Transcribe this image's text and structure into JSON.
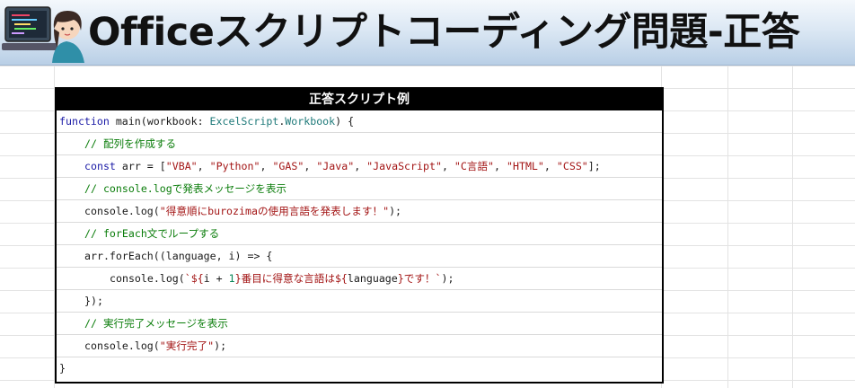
{
  "banner": {
    "title": "Officeスクリプトコーディング問題-正答"
  },
  "code_block": {
    "header": "正答スクリプト例",
    "lines": [
      {
        "indent": 0,
        "tokens": [
          {
            "t": "kw",
            "v": "function"
          },
          {
            "t": "pl",
            "v": " main(workbook: "
          },
          {
            "t": "ty",
            "v": "ExcelScript"
          },
          {
            "t": "pl",
            "v": "."
          },
          {
            "t": "ty",
            "v": "Workbook"
          },
          {
            "t": "pl",
            "v": ") {"
          }
        ]
      },
      {
        "indent": 1,
        "tokens": [
          {
            "t": "cm",
            "v": "// 配列を作成する"
          }
        ]
      },
      {
        "indent": 1,
        "tokens": [
          {
            "t": "kw",
            "v": "const"
          },
          {
            "t": "pl",
            "v": " arr = ["
          },
          {
            "t": "st",
            "v": "\"VBA\""
          },
          {
            "t": "pl",
            "v": ", "
          },
          {
            "t": "st",
            "v": "\"Python\""
          },
          {
            "t": "pl",
            "v": ", "
          },
          {
            "t": "st",
            "v": "\"GAS\""
          },
          {
            "t": "pl",
            "v": ", "
          },
          {
            "t": "st",
            "v": "\"Java\""
          },
          {
            "t": "pl",
            "v": ", "
          },
          {
            "t": "st",
            "v": "\"JavaScript\""
          },
          {
            "t": "pl",
            "v": ", "
          },
          {
            "t": "st",
            "v": "\"C言語\""
          },
          {
            "t": "pl",
            "v": ", "
          },
          {
            "t": "st",
            "v": "\"HTML\""
          },
          {
            "t": "pl",
            "v": ", "
          },
          {
            "t": "st",
            "v": "\"CSS\""
          },
          {
            "t": "pl",
            "v": "];"
          }
        ]
      },
      {
        "indent": 1,
        "tokens": [
          {
            "t": "cm",
            "v": "// console.logで発表メッセージを表示"
          }
        ]
      },
      {
        "indent": 1,
        "tokens": [
          {
            "t": "pl",
            "v": "console.log("
          },
          {
            "t": "st",
            "v": "\"得意順にburozimaの使用言語を発表します！\""
          },
          {
            "t": "pl",
            "v": ");"
          }
        ]
      },
      {
        "indent": 1,
        "tokens": [
          {
            "t": "cm",
            "v": "// forEach文でループする"
          }
        ]
      },
      {
        "indent": 1,
        "tokens": [
          {
            "t": "pl",
            "v": "arr.forEach((language, i) => {"
          }
        ]
      },
      {
        "indent": 2,
        "tokens": [
          {
            "t": "pl",
            "v": "console.log("
          },
          {
            "t": "st",
            "v": "`${"
          },
          {
            "t": "pl",
            "v": "i + "
          },
          {
            "t": "nm",
            "v": "1"
          },
          {
            "t": "st",
            "v": "}番目に得意な言語は${"
          },
          {
            "t": "pl",
            "v": "language"
          },
          {
            "t": "st",
            "v": "}です！`"
          },
          {
            "t": "pl",
            "v": ");"
          }
        ]
      },
      {
        "indent": 1,
        "tokens": [
          {
            "t": "pl",
            "v": "});"
          }
        ]
      },
      {
        "indent": 1,
        "tokens": [
          {
            "t": "cm",
            "v": "// 実行完了メッセージを表示"
          }
        ]
      },
      {
        "indent": 1,
        "tokens": [
          {
            "t": "pl",
            "v": "console.log("
          },
          {
            "t": "st",
            "v": "\"実行完了\""
          },
          {
            "t": "pl",
            "v": ");"
          }
        ]
      },
      {
        "indent": 0,
        "tokens": [
          {
            "t": "pl",
            "v": "}"
          }
        ]
      }
    ]
  },
  "colors": {
    "keyword": "#1a1aa6",
    "type": "#1f7a7a",
    "comment": "#0b7d0b",
    "string": "#a31515",
    "number": "#098658",
    "header_bg": "#000000"
  }
}
